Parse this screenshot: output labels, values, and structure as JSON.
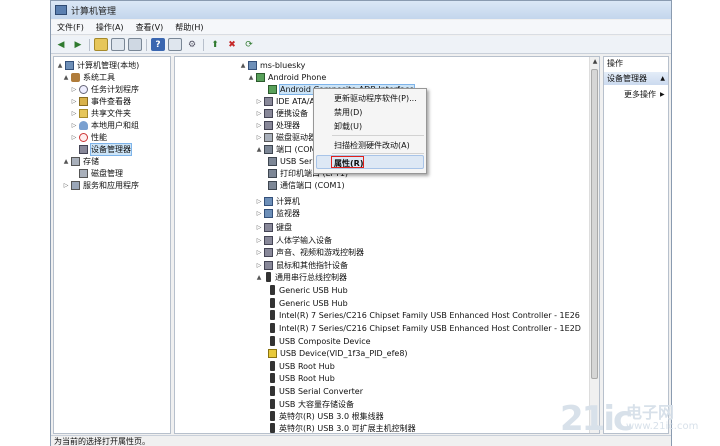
{
  "window": {
    "title": "计算机管理"
  },
  "menu": [
    "文件(F)",
    "操作(A)",
    "查看(V)",
    "帮助(H)"
  ],
  "toolbar": [
    "back-arrow-icon",
    "forward-arrow-icon",
    "up-folder-icon",
    "properties-icon",
    "list-icon",
    "help-icon",
    "console-icon",
    "update-driver-icon",
    "disable-icon",
    "scan-icon"
  ],
  "left_tree": [
    {
      "label": "计算机管理(本地)",
      "level": 0,
      "icon": "computer-icon",
      "expander": "▲"
    },
    {
      "label": "系统工具",
      "level": 1,
      "icon": "tools-icon",
      "expander": "▲"
    },
    {
      "label": "任务计划程序",
      "level": 2,
      "icon": "clock-icon",
      "expander": "▷"
    },
    {
      "label": "事件查看器",
      "level": 2,
      "icon": "event-viewer-icon",
      "expander": "▷"
    },
    {
      "label": "共享文件夹",
      "level": 2,
      "icon": "shared-folder-icon",
      "expander": "▷"
    },
    {
      "label": "本地用户和组",
      "level": 2,
      "icon": "users-icon",
      "expander": "▷"
    },
    {
      "label": "性能",
      "level": 2,
      "icon": "performance-icon",
      "expander": "▷"
    },
    {
      "label": "设备管理器",
      "level": 2,
      "icon": "device-manager-icon",
      "expander": "",
      "selected": true
    },
    {
      "label": "存储",
      "level": 1,
      "icon": "storage-icon",
      "expander": "▲"
    },
    {
      "label": "磁盘管理",
      "level": 2,
      "icon": "disk-icon",
      "expander": ""
    },
    {
      "label": "服务和应用程序",
      "level": 1,
      "icon": "services-icon",
      "expander": "▷"
    }
  ],
  "device_tree": [
    {
      "label": "ms-bluesky",
      "level": 0,
      "icon": "computer-icon",
      "expander": "▲"
    },
    {
      "label": "Android Phone",
      "level": 1,
      "icon": "phone-icon",
      "expander": "▲"
    },
    {
      "label": "Android Composite ADB Interface",
      "level": 2,
      "icon": "phone-icon",
      "expander": "",
      "selected": true
    },
    {
      "label": "IDE ATA/ATAPI 控制器",
      "level": 1,
      "icon": "ide-icon",
      "expander": "▷"
    },
    {
      "label": "便携设备",
      "level": 1,
      "icon": "portable-icon",
      "expander": "▷"
    },
    {
      "label": "处理器",
      "level": 1,
      "icon": "cpu-icon",
      "expander": "▷"
    },
    {
      "label": "磁盘驱动器",
      "level": 1,
      "icon": "disk-icon",
      "expander": "▷"
    },
    {
      "label": "端口 (COM 和 LPT)",
      "level": 1,
      "icon": "port-icon",
      "expander": "▲"
    },
    {
      "label": "USB Serial Port (COM2)",
      "level": 2,
      "icon": "port-icon",
      "expander": ""
    },
    {
      "label": "打印机端口 (LPT1)",
      "level": 2,
      "icon": "port-icon",
      "expander": ""
    },
    {
      "label": "通信端口 (COM1)",
      "level": 2,
      "icon": "port-icon",
      "expander": ""
    },
    {
      "label": "计算机",
      "level": 1,
      "icon": "computer-icon",
      "expander": "▷"
    },
    {
      "label": "监视器",
      "level": 1,
      "icon": "monitor-icon",
      "expander": "▷"
    },
    {
      "label": "键盘",
      "level": 1,
      "icon": "keyboard-icon",
      "expander": "▷"
    },
    {
      "label": "人体学输入设备",
      "level": 1,
      "icon": "hid-icon",
      "expander": "▷"
    },
    {
      "label": "声音、视频和游戏控制器",
      "level": 1,
      "icon": "sound-icon",
      "expander": "▷"
    },
    {
      "label": "鼠标和其他指针设备",
      "level": 1,
      "icon": "mouse-icon",
      "expander": "▷"
    },
    {
      "label": "通用串行总线控制器",
      "level": 1,
      "icon": "usb-icon",
      "expander": "▲"
    },
    {
      "label": "Generic USB Hub",
      "level": 2,
      "icon": "usb-icon",
      "expander": ""
    },
    {
      "label": "Generic USB Hub",
      "level": 2,
      "icon": "usb-icon",
      "expander": ""
    },
    {
      "label": "Intel(R) 7 Series/C216 Chipset Family USB Enhanced Host Controller - 1E26",
      "level": 2,
      "icon": "usb-icon",
      "expander": ""
    },
    {
      "label": "Intel(R) 7 Series/C216 Chipset Family USB Enhanced Host Controller - 1E2D",
      "level": 2,
      "icon": "usb-icon",
      "expander": ""
    },
    {
      "label": "USB Composite Device",
      "level": 2,
      "icon": "usb-icon",
      "expander": ""
    },
    {
      "label": "USB Device(VID_1f3a_PID_efe8)",
      "level": 2,
      "icon": "usb-warning-icon",
      "expander": ""
    },
    {
      "label": "USB Root Hub",
      "level": 2,
      "icon": "usb-icon",
      "expander": ""
    },
    {
      "label": "USB Root Hub",
      "level": 2,
      "icon": "usb-icon",
      "expander": ""
    },
    {
      "label": "USB Serial Converter",
      "level": 2,
      "icon": "usb-icon",
      "expander": ""
    },
    {
      "label": "USB 大容量存储设备",
      "level": 2,
      "icon": "usb-icon",
      "expander": ""
    },
    {
      "label": "英特尔(R) USB 3.0 根集线器",
      "level": 2,
      "icon": "usb-icon",
      "expander": ""
    },
    {
      "label": "英特尔(R) USB 3.0 可扩展主机控制器",
      "level": 2,
      "icon": "usb-icon",
      "expander": ""
    }
  ],
  "context_menu": {
    "update_driver": "更新驱动程序软件(P)...",
    "disable": "禁用(D)",
    "uninstall": "卸载(U)",
    "scan": "扫描检测硬件改动(A)",
    "properties": "属性(R)"
  },
  "actions_pane": {
    "title": "操作",
    "section": "设备管理器",
    "more": "更多操作",
    "section_arrow": "▲",
    "more_arrow": "▶"
  },
  "status": "为当前的选择打开属性页。",
  "watermark": {
    "logo": "21ic",
    "cn": "电子网",
    "url": "www.21ic.com"
  },
  "colors": {
    "highlight": "#cce4f7",
    "red_box": "#e0201b",
    "title_bar": "#c3d6ec"
  }
}
